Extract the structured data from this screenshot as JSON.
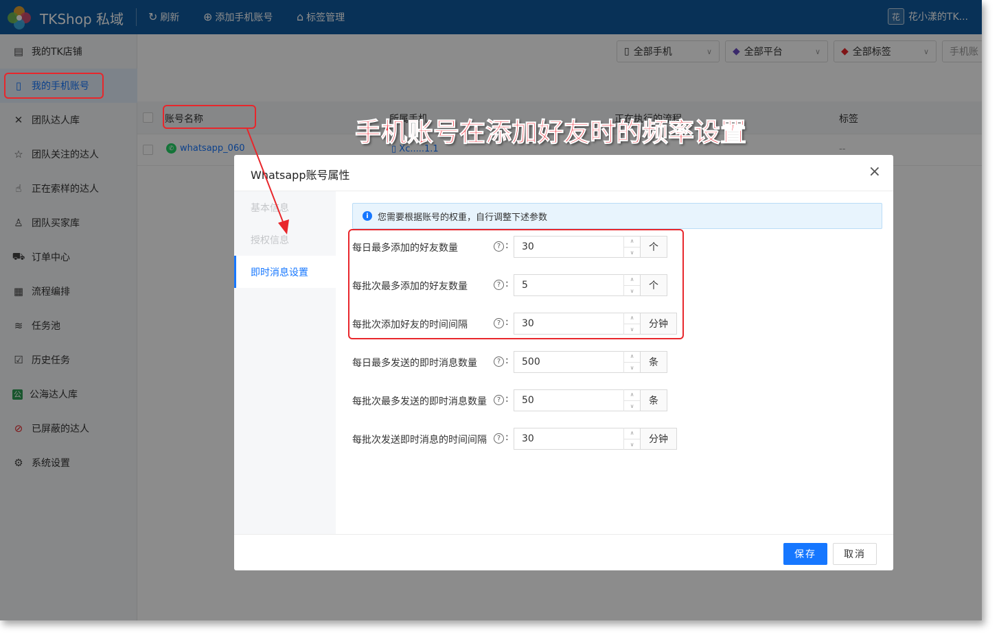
{
  "topbar": {
    "app_title": "TKShop 私域",
    "buttons": [
      {
        "icon": "refresh-icon",
        "glyph": "↻",
        "label": "刷新"
      },
      {
        "icon": "add-circle-icon",
        "glyph": "⊕",
        "label": "添加手机账号"
      },
      {
        "icon": "tag-icon",
        "glyph": "⌂",
        "label": "标签管理"
      }
    ],
    "user_avatar": "花",
    "user_name": "花小漾的TK..."
  },
  "sidebar": {
    "items": [
      {
        "label": "我的TK店铺",
        "icon": "store-icon",
        "glyph": "▤",
        "active": false
      },
      {
        "label": "我的手机账号",
        "icon": "phone-icon",
        "glyph": "▯",
        "active": true
      },
      {
        "label": "团队达人库",
        "icon": "creator-icon",
        "glyph": "✕",
        "active": false
      },
      {
        "label": "团队关注的达人",
        "icon": "star-icon",
        "glyph": "☆",
        "active": false
      },
      {
        "label": "正在索样的达人",
        "icon": "hand-icon",
        "glyph": "☝",
        "active": false
      },
      {
        "label": "团队买家库",
        "icon": "user-icon",
        "glyph": "♙",
        "active": false
      },
      {
        "label": "订单中心",
        "icon": "truck-icon",
        "glyph": "⛟",
        "active": false
      },
      {
        "label": "流程编排",
        "icon": "calendar-icon",
        "glyph": "▦",
        "active": false
      },
      {
        "label": "任务池",
        "icon": "layers-icon",
        "glyph": "≋",
        "active": false
      },
      {
        "label": "历史任务",
        "icon": "clipboard-icon",
        "glyph": "☑",
        "active": false
      },
      {
        "label": "公海达人库",
        "icon": "public-icon",
        "glyph": "公",
        "active": false
      },
      {
        "label": "已屏蔽的达人",
        "icon": "block-icon",
        "glyph": "⊘",
        "active": false
      },
      {
        "label": "系统设置",
        "icon": "gear-icon",
        "glyph": "⚙",
        "active": false
      }
    ]
  },
  "filters": [
    {
      "icon": "phone-icon",
      "glyph": "▯",
      "label": "全部手机"
    },
    {
      "icon": "platform-icon",
      "glyph": "◆",
      "label": "全部平台"
    },
    {
      "icon": "tag-icon",
      "glyph": "◆",
      "label": "全部标签"
    },
    {
      "icon": "",
      "glyph": "",
      "label": "手机账"
    }
  ],
  "table": {
    "headers": [
      "账号名称",
      "所属手机",
      "正在执行的流程",
      "标签"
    ],
    "rows": [
      {
        "account": "whatsapp_060",
        "phone": "▯ Xc.....1.1",
        "flow": "",
        "tag": "--"
      }
    ]
  },
  "modal": {
    "title": "Whatsapp账号属性",
    "close_glyph": "×",
    "tabs": [
      "基本信息",
      "授权信息",
      "即时消息设置"
    ],
    "active_tab": 2,
    "alert": "您需要根据账号的权重，自行调整下述参数",
    "fields": [
      {
        "label": "每日最多添加的好友数量",
        "value": "30",
        "unit": "个"
      },
      {
        "label": "每批次最多添加的好友数量",
        "value": "5",
        "unit": "个"
      },
      {
        "label": "每批次添加好友的时间间隔",
        "value": "30",
        "unit": "分钟"
      },
      {
        "label": "每日最多发送的即时消息数量",
        "value": "500",
        "unit": "条"
      },
      {
        "label": "每批次最多发送的即时消息数量",
        "value": "50",
        "unit": "条"
      },
      {
        "label": "每批次发送即时消息的时间间隔",
        "value": "30",
        "unit": "分钟"
      }
    ],
    "save_label": "保存",
    "cancel_label": "取消"
  },
  "annotation": {
    "caption": "手机账号在添加好友时的频率设置",
    "color": "#e8262b"
  },
  "colors": {
    "topbar": "#0f5a9e",
    "primary": "#1677ff",
    "whatsapp": "#25d366"
  }
}
